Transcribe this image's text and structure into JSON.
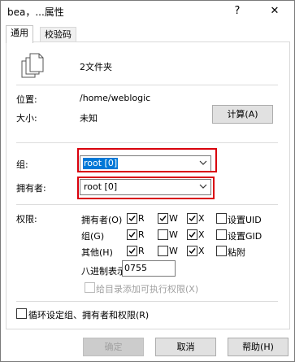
{
  "window": {
    "title": "bea，...属性",
    "help_glyph": "?",
    "close_glyph": "✕"
  },
  "tabs": [
    "通用",
    "校验码"
  ],
  "general": {
    "name": "2文件夹",
    "location_label": "位置:",
    "location_value": "/home/weblogic",
    "size_label": "大小:",
    "size_value": "未知",
    "calc_button": "计算(A)",
    "group_label": "组:",
    "group_value": "root [0]",
    "owner_label": "拥有者:",
    "owner_value": "root [0]",
    "perm_label": "权限:",
    "perm_rows": [
      {
        "label": "拥有者(O)",
        "r": true,
        "w": true,
        "x": true,
        "extra": "设置UID",
        "extra_checked": false
      },
      {
        "label": "组(G)",
        "r": true,
        "w": false,
        "x": true,
        "extra": "设置GID",
        "extra_checked": false
      },
      {
        "label": "其他(H)",
        "r": true,
        "w": false,
        "x": true,
        "extra": "粘附",
        "extra_checked": false
      }
    ],
    "perm_cols": {
      "r": "R",
      "w": "W",
      "x": "X"
    },
    "octal_label": "八进制表示",
    "octal_value": "0755",
    "add_exec_label": "给目录添加可执行权限(X)",
    "recurse_label": "循环设定组、拥有者和权限(R)"
  },
  "footer": {
    "ok": "确定",
    "cancel": "取消",
    "help": "帮助(H)"
  }
}
